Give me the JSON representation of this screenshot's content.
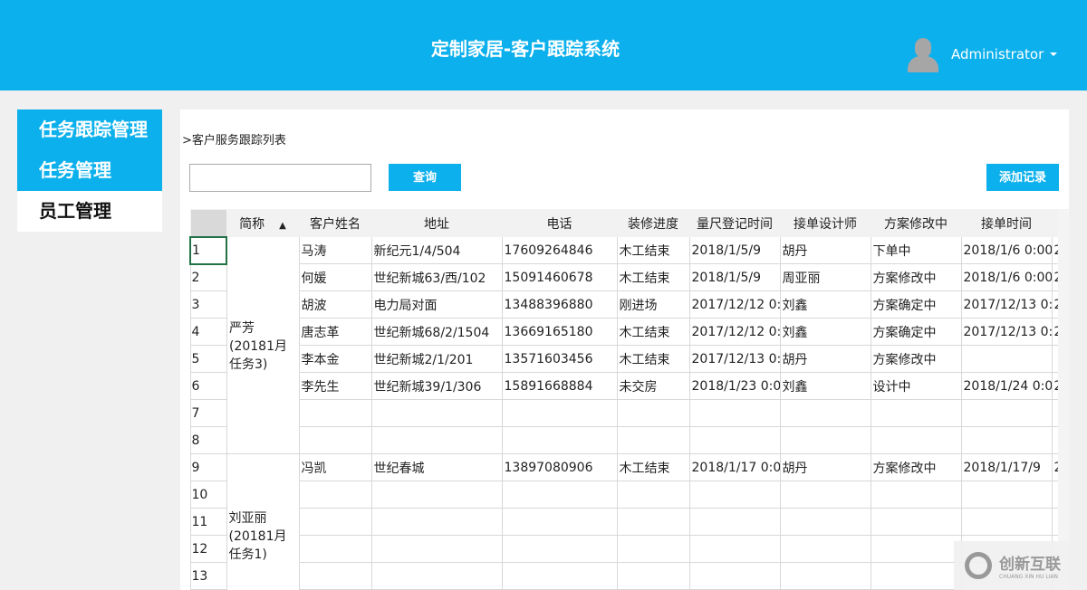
{
  "header": {
    "title": "定制家居-客户跟踪系统",
    "user": "Administrator"
  },
  "sidebar": {
    "items": [
      {
        "label": "任务跟踪管理"
      },
      {
        "label": "任务管理"
      },
      {
        "label": "员工管理"
      }
    ]
  },
  "breadcrumb": ">客户服务跟踪列表",
  "search": {
    "value": "",
    "query_label": "查询",
    "add_label": "添加记录"
  },
  "table": {
    "columns": [
      "",
      "简称",
      "客户姓名",
      "地址",
      "电话",
      "装修进度",
      "量尺登记时间",
      "接单设计师",
      "方案修改中",
      "接单时间",
      ""
    ],
    "sort_indicator": "▲",
    "groups": [
      {
        "name": "严芳(20181月任务3)",
        "rows": [
          [
            "1",
            "马涛",
            "新纪元1/4/504",
            "17609264846",
            "木工结束",
            "2018/1/5/9",
            "胡丹",
            "下单中",
            "2018/1/6 0:00",
            "2"
          ],
          [
            "2",
            "何媛",
            "世纪新城63/西/102",
            "15091460678",
            "木工结束",
            "2018/1/5/9",
            "周亚丽",
            "方案修改中",
            "2018/1/6 0:00",
            "2"
          ],
          [
            "3",
            "胡波",
            "电力局对面",
            "13488396880",
            "刚进场",
            "2017/12/12 0:",
            "刘鑫",
            "方案确定中",
            "2017/12/13 0:",
            "2"
          ],
          [
            "4",
            "唐志革",
            "世纪新城68/2/1504",
            "13669165180",
            "木工结束",
            "2017/12/12 0:",
            "刘鑫",
            "方案确定中",
            "2017/12/13 0:",
            "2"
          ],
          [
            "5",
            "李本金",
            "世纪新城2/1/201",
            "13571603456",
            "木工结束",
            "2017/12/13 0:",
            "胡丹",
            "方案修改中",
            "",
            ""
          ],
          [
            "6",
            "李先生",
            "世纪新城39/1/306",
            "15891668884",
            "未交房",
            "2018/1/23 0:0",
            "刘鑫",
            "设计中",
            "2018/1/24 0:0",
            "2"
          ],
          [
            "7",
            "",
            "",
            "",
            "",
            "",
            "",
            "",
            "",
            ""
          ],
          [
            "8",
            "",
            "",
            "",
            "",
            "",
            "",
            "",
            "",
            ""
          ]
        ]
      },
      {
        "name": "刘亚丽(20181月任务1)",
        "rows": [
          [
            "9",
            "冯凯",
            "世纪春城",
            "13897080906",
            "木工结束",
            "2018/1/17 0:0",
            "胡丹",
            "方案修改中",
            "2018/1/17/9",
            "2"
          ],
          [
            "10",
            "",
            "",
            "",
            "",
            "",
            "",
            "",
            "",
            ""
          ],
          [
            "11",
            "",
            "",
            "",
            "",
            "",
            "",
            "",
            "",
            ""
          ],
          [
            "12",
            "",
            "",
            "",
            "",
            "",
            "",
            "",
            "",
            ""
          ],
          [
            "13",
            "",
            "",
            "",
            "",
            "",
            "",
            "",
            "",
            ""
          ],
          [
            "",
            "",
            "",
            "",
            "",
            "",
            "",
            "",
            "",
            ""
          ]
        ]
      }
    ]
  },
  "watermark": {
    "cn": "创新互联",
    "en": "CHUANG XIN HU LIAN"
  }
}
